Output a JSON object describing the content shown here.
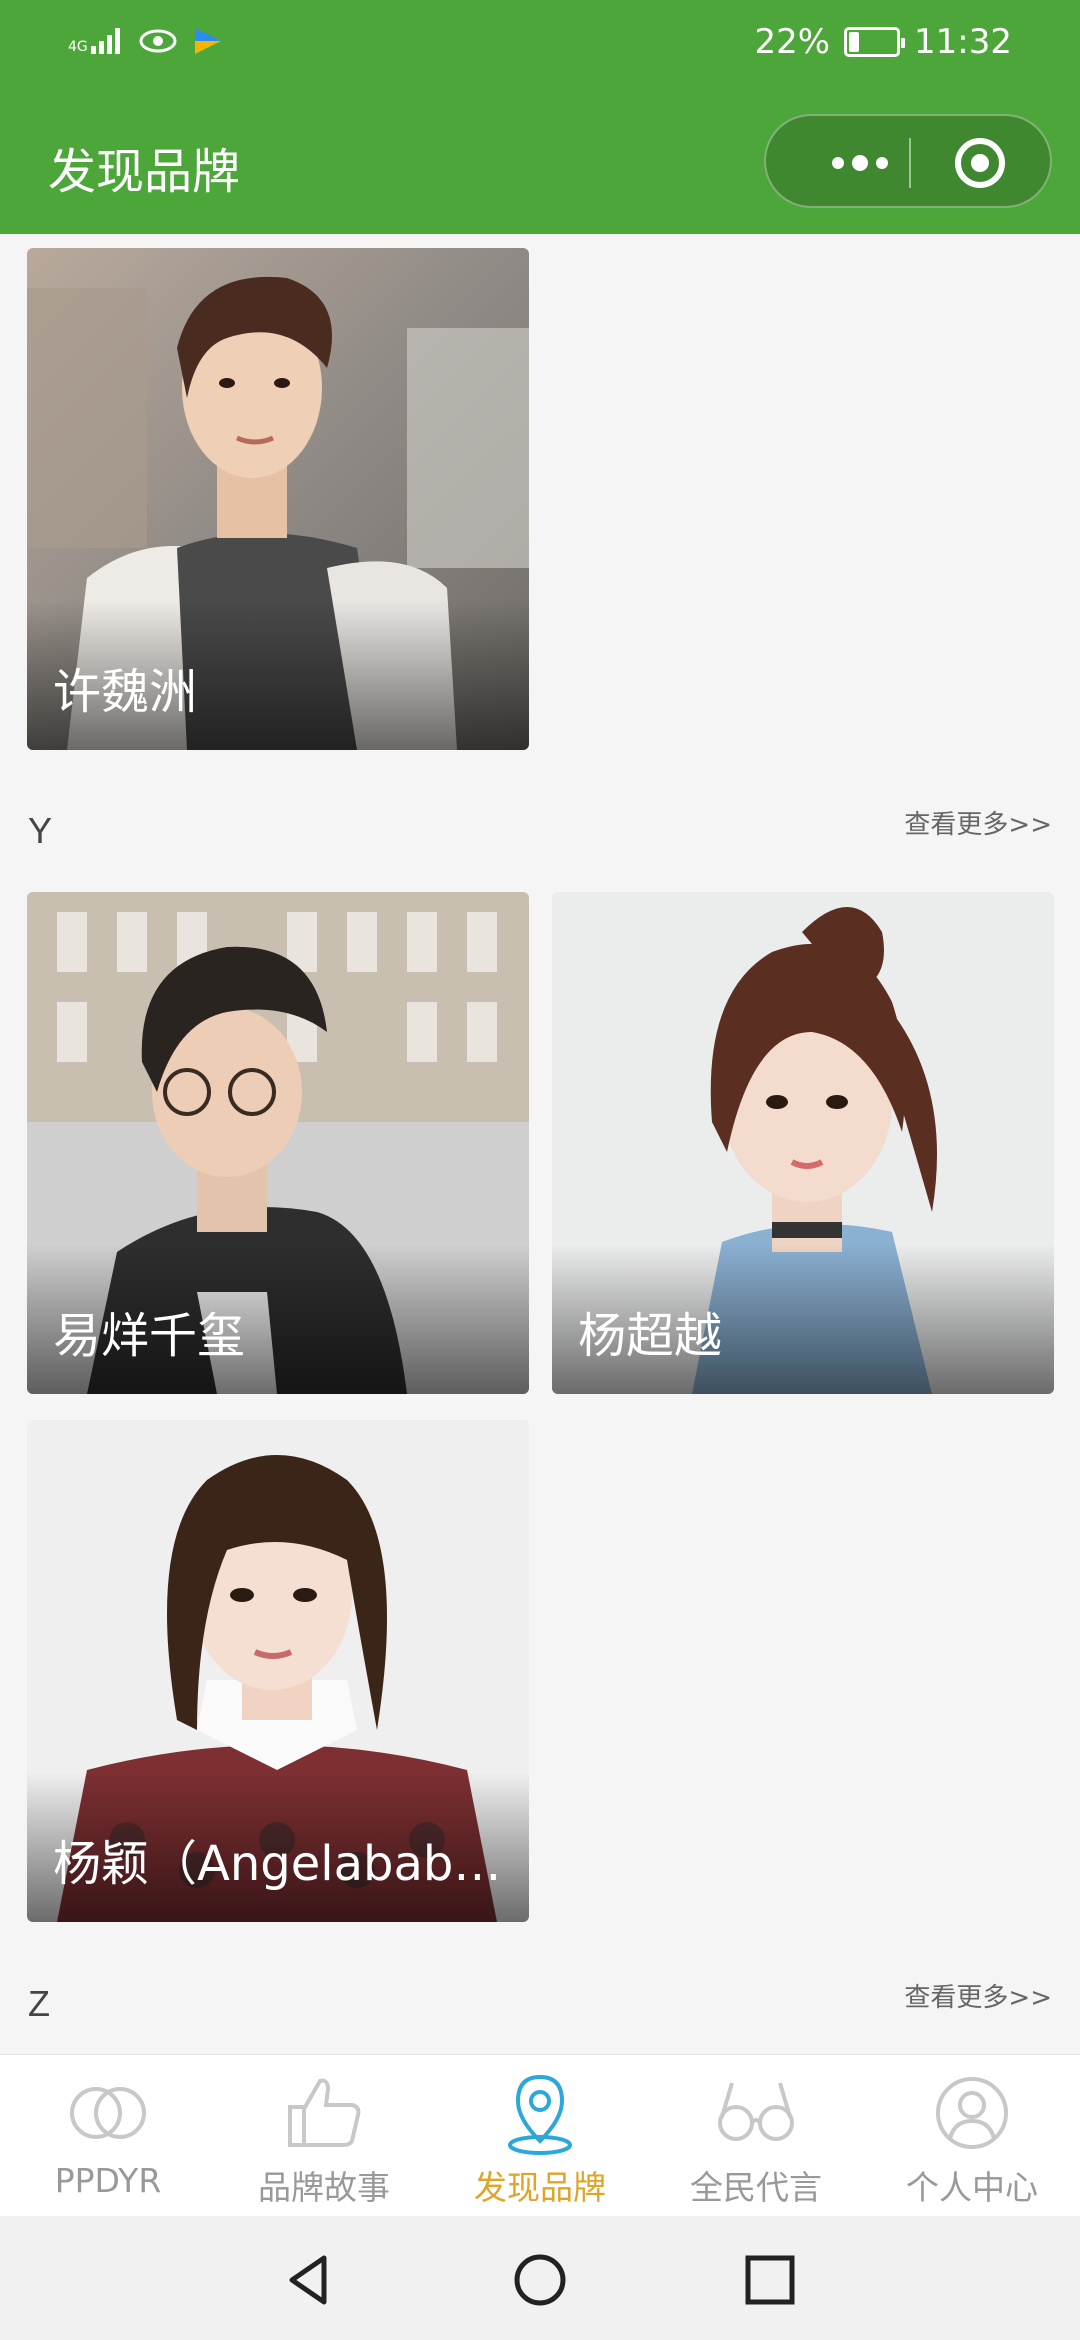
{
  "status_bar": {
    "network": "4G",
    "battery_percent": "22%",
    "battery_level": 0.22,
    "time": "11:32",
    "icons": [
      "signal-icon",
      "eye-icon",
      "app-notification-icon",
      "battery-icon"
    ]
  },
  "nav": {
    "title": "发现品牌",
    "capsule": {
      "more_icon": "more-dots-icon",
      "close_icon": "target-close-icon"
    }
  },
  "sections": [
    {
      "letter": "",
      "more_label": "",
      "cards": [
        {
          "name": "许魏洲"
        }
      ]
    },
    {
      "letter": "Y",
      "more_label": "查看更多>>",
      "cards": [
        {
          "name": "易烊千玺"
        },
        {
          "name": "杨超越"
        },
        {
          "name": "杨颖（Angelababy…"
        }
      ]
    },
    {
      "letter": "Z",
      "more_label": "查看更多>>",
      "cards": []
    }
  ],
  "tabbar": {
    "active_color": "#e0a429",
    "inactive_color": "#999999",
    "tabs": [
      {
        "label": "PPDYR",
        "icon": "double-circle-icon",
        "active": false
      },
      {
        "label": "品牌故事",
        "icon": "thumbs-up-icon",
        "active": false
      },
      {
        "label": "发现品牌",
        "icon": "location-pin-icon",
        "active": true
      },
      {
        "label": "全民代言",
        "icon": "glasses-icon",
        "active": false
      },
      {
        "label": "个人中心",
        "icon": "user-circle-icon",
        "active": false
      }
    ]
  },
  "system_nav": {
    "icons": [
      "back-icon",
      "home-icon",
      "recents-icon"
    ]
  },
  "colors": {
    "header_green": "#4da63a",
    "background": "#f5f5f6"
  }
}
